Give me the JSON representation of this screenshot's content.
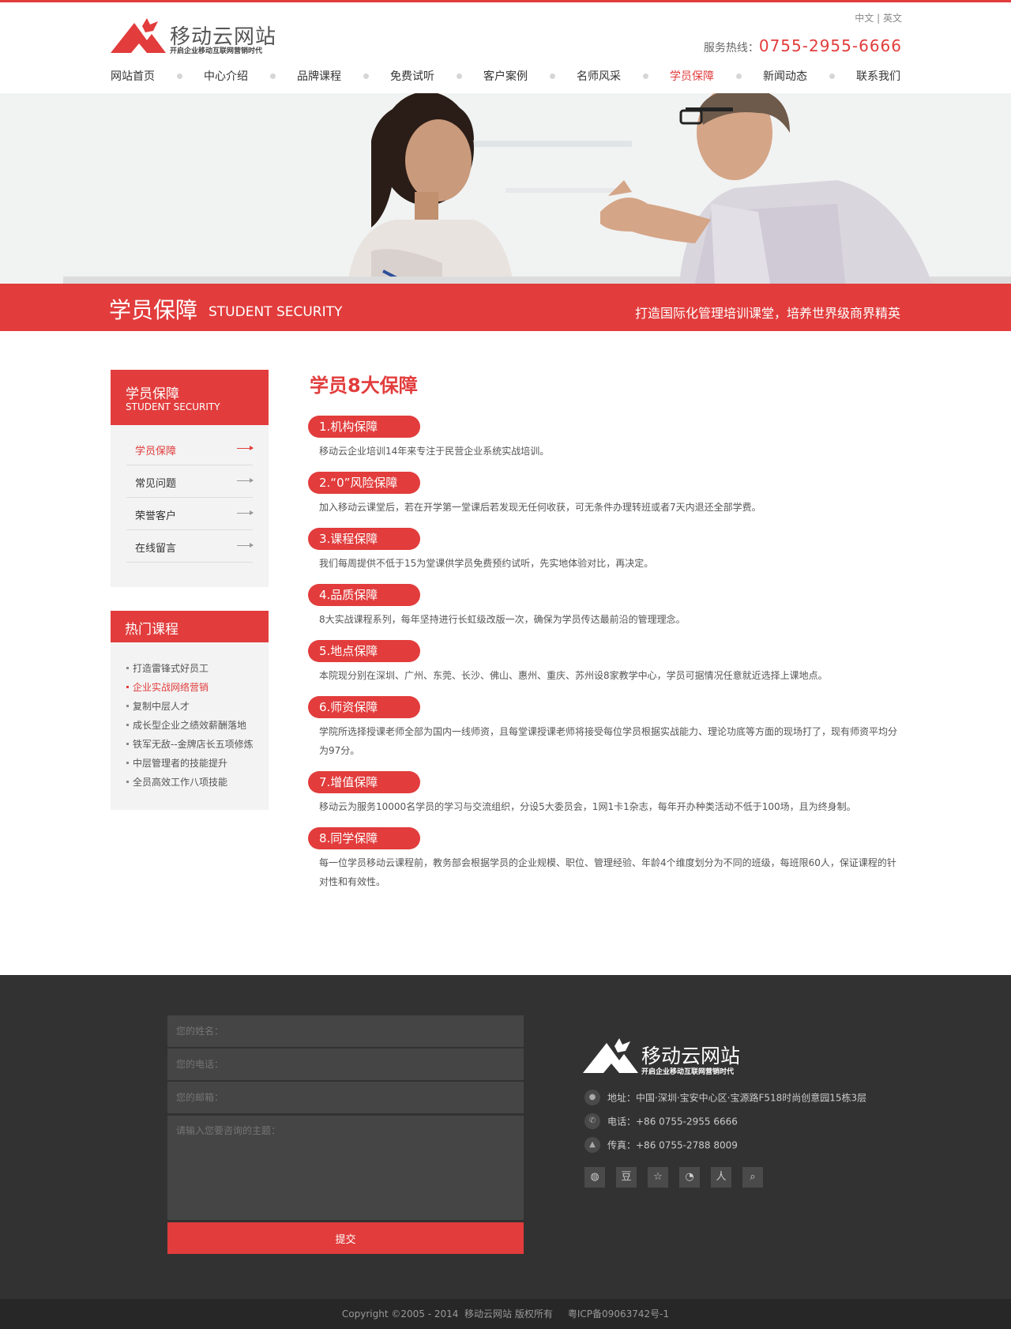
{
  "header": {
    "brand": "移动云网站",
    "slogan": "开启企业移动互联网营销时代",
    "lang_cn": "中文",
    "lang_sep": "|",
    "lang_en": "英文",
    "hotline_label": "服务热线：",
    "hotline_number": "0755-2955-6666"
  },
  "nav": [
    {
      "label": "网站首页"
    },
    {
      "label": "中心介绍"
    },
    {
      "label": "品牌课程"
    },
    {
      "label": "免费试听"
    },
    {
      "label": "客户案例"
    },
    {
      "label": "名师风采"
    },
    {
      "label": "学员保障",
      "active": true
    },
    {
      "label": "新闻动态"
    },
    {
      "label": "联系我们"
    }
  ],
  "banner": {
    "title_cn": "学员保障",
    "title_en": "STUDENT SECURITY",
    "motto": "打造国际化管理培训课堂，培养世界级商界精英"
  },
  "sidebar": {
    "title_cn": "学员保障",
    "title_en": "STUDENT SECURITY",
    "items": [
      {
        "label": "学员保障",
        "active": true
      },
      {
        "label": "常见问题"
      },
      {
        "label": "荣誉客户"
      },
      {
        "label": "在线留言"
      }
    ]
  },
  "hot": {
    "title": "热门课程",
    "items": [
      {
        "label": "打造雷锋式好员工"
      },
      {
        "label": "企业实战网络营销",
        "active": true
      },
      {
        "label": "复制中层人才"
      },
      {
        "label": "成长型企业之绩效薪酬落地"
      },
      {
        "label": "铁军无敌--金牌店长五项修炼"
      },
      {
        "label": "中层管理者的技能提升"
      },
      {
        "label": "全员高效工作八项技能"
      }
    ]
  },
  "content": {
    "title": "学员8大保障",
    "sections": [
      {
        "heading": "1.机构保障",
        "text": "移动云企业培训14年来专注于民营企业系统实战培训。"
      },
      {
        "heading": "2.“0”风险保障",
        "text": "加入移动云课堂后，若在开学第一堂课后若发现无任何收获，可无条件办理转班或者7天内退还全部学费。"
      },
      {
        "heading": "3.课程保障",
        "text": "我们每周提供不低于15为堂课供学员免费预约试听，先实地体验对比，再决定。"
      },
      {
        "heading": "4.品质保障",
        "text": "8大实战课程系列，每年坚持进行长虹级改版一次，确保为学员传达最前沿的管理理念。"
      },
      {
        "heading": "5.地点保障",
        "text": "本院现分别在深圳、广州、东莞、长沙、佛山、惠州、重庆、苏州设8家教学中心，学员可据情况任意就近选择上课地点。"
      },
      {
        "heading": "6.师资保障",
        "text": "学院所选择授课老师全部为国内一线师资，且每堂课授课老师将接受每位学员根据实战能力、理论功底等方面的现场打了，现有师资平均分为97分。"
      },
      {
        "heading": "7.增值保障",
        "text": "移动云为服务10000名学员的学习与交流组织，分设5大委员会，1网1卡1杂志，每年开办种类活动不低于100场，且为终身制。"
      },
      {
        "heading": "8.同学保障",
        "text": "每一位学员移动云课程前，教务部会根据学员的企业规模、职位、管理经验、年龄4个维度划分为不同的班级，每班限60人，保证课程的针对性和有效性。"
      }
    ]
  },
  "footer": {
    "form": {
      "name_placeholder": "您的姓名：",
      "phone_placeholder": "您的电话：",
      "email_placeholder": "您的邮箱：",
      "topic_placeholder": "请输入您要咨询的主题：",
      "submit": "提交"
    },
    "brand": "移动云网站",
    "slogan": "开启企业移动互联网营销时代",
    "address": "地址：中国·深圳·宝安中心区·宝源路F518时尚创意园15栋3层",
    "phone": "电话：+86 0755-2955 6666",
    "fax": "传真：+86 0755-2788 8009",
    "social": [
      "wechat-icon",
      "douban-icon",
      "qzone-icon",
      "weibo-icon",
      "renren-icon",
      "search-icon"
    ],
    "copyright": "Copyright ©2005 - 2014  移动云网站 版权所有     粤ICP备09063742号-1"
  },
  "colors": {
    "accent": "#e23c3c",
    "footer": "#323232",
    "footer_bottom": "#272727"
  }
}
